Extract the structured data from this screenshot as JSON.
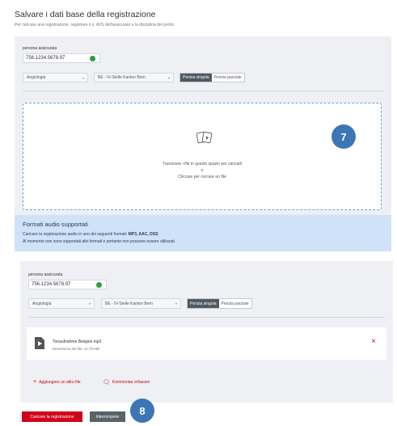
{
  "header": {
    "title": "Salvare i dati base della registrazione",
    "subtitle": "Per caricare una registrazione, registrare il n. AVS dell'assicurato e la disciplina del perito."
  },
  "panel_top": {
    "ssn_label": "persona assicurata",
    "ssn_value": "756.1234.5678.97",
    "discipline": "Angiologia",
    "location": "BE - IV-Stelle Kanton Bern",
    "expertise_options": [
      "Perizia singola",
      "Perizia parziale"
    ],
    "expertise_selected": "Perizia singola",
    "dropzone": {
      "line1": "Trascinare i file in questo spazio per caricarli",
      "or": "o",
      "line2": "Cliccare per cercare un file"
    },
    "info": {
      "title": "Formati audio supportati",
      "line1_prefix": "Caricare la registrazione audio in uno dei seguenti formati: ",
      "line1_formats": "MP3, AAC, DSS",
      "line2": "Al momento non sono supportati altri formati e pertanto non possono essere utilizzati."
    },
    "badge": "7"
  },
  "panel_bottom": {
    "ssn_label": "persona assicurata",
    "ssn_value": "756.1234.5678.97",
    "discipline": "Angiologia",
    "location": "BE - IV-Stelle Kanton Bern",
    "expertise_options": [
      "Perizia singola",
      "Perizia parziale"
    ],
    "expertise_selected": "Perizia singola",
    "file": {
      "name": "Tonaufnahme Beispiel.mp3",
      "size": "Dimensioni del file: 11,75 MB"
    },
    "add_file_label": "Aggiungere un altro file",
    "comment_label": "Kommentar erfassen"
  },
  "footer": {
    "submit_label": "Caricare la registrazione",
    "cancel_label": "Interrompere",
    "badge": "8"
  },
  "colors": {
    "accent_red": "#d0021b",
    "badge_blue": "#3d76b6",
    "info_bg": "#cfe2f7",
    "ok_green": "#2e9e3e"
  }
}
